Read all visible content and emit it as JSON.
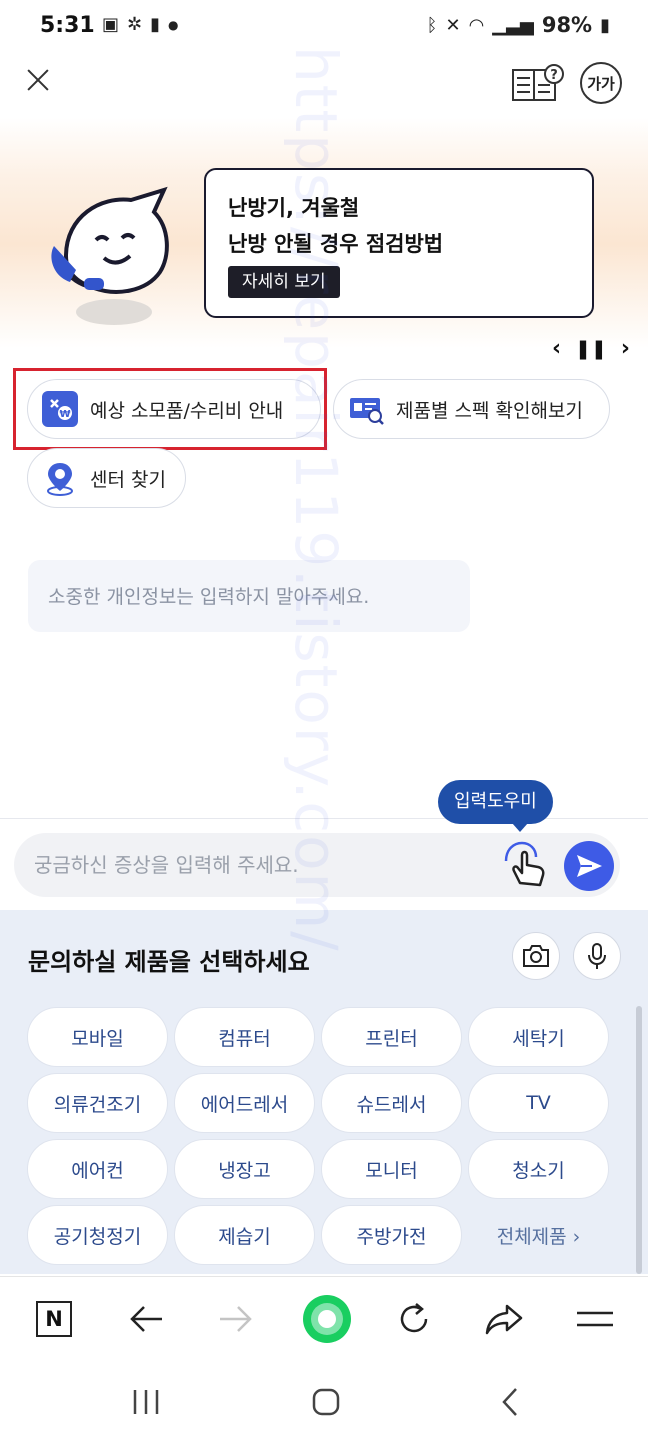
{
  "status_bar": {
    "time": "5:31",
    "battery": "98%",
    "left_icons": [
      "gallery-icon",
      "network-icon",
      "phone-icon",
      "dot-icon"
    ],
    "right_icons": [
      "bluetooth-icon",
      "mute-icon",
      "wifi-icon",
      "signal-icon",
      "battery-icon"
    ]
  },
  "header": {
    "font_size_label": "가가"
  },
  "banner": {
    "title_line1": "난방기, 겨울철",
    "title_line2": "난방 안될 경우 점검방법",
    "detail_button": "자세히 보기"
  },
  "quick_menu": {
    "items": [
      {
        "label": "예상 소모품/수리비 안내",
        "icon": "repair-cost-icon"
      },
      {
        "label": "제품별 스펙 확인해보기",
        "icon": "spec-search-icon"
      },
      {
        "label": "센터 찾기",
        "icon": "location-pin-icon"
      }
    ]
  },
  "privacy_notice": "소중한 개인정보는 입력하지 말아주세요.",
  "input": {
    "helper_label": "입력도우미",
    "placeholder": "궁금하신 증상을 입력해 주세요."
  },
  "product_panel": {
    "title": "문의하실 제품을 선택하세요",
    "products": [
      "모바일",
      "컴퓨터",
      "프린터",
      "세탁기",
      "의류건조기",
      "에어드레서",
      "슈드레서",
      "TV",
      "에어컨",
      "냉장고",
      "모니터",
      "청소기",
      "공기청정기",
      "제습기",
      "주방가전"
    ],
    "all_products": "전체제품 ›"
  },
  "browser_toolbar": {
    "home_label": "N"
  },
  "watermark_text": "https://repair119.tistory.com/",
  "colors": {
    "accent_blue": "#3e5be6",
    "helper_blue": "#1f4fa8",
    "highlight_red": "#d7232f",
    "panel_bg": "#e9eef7"
  }
}
